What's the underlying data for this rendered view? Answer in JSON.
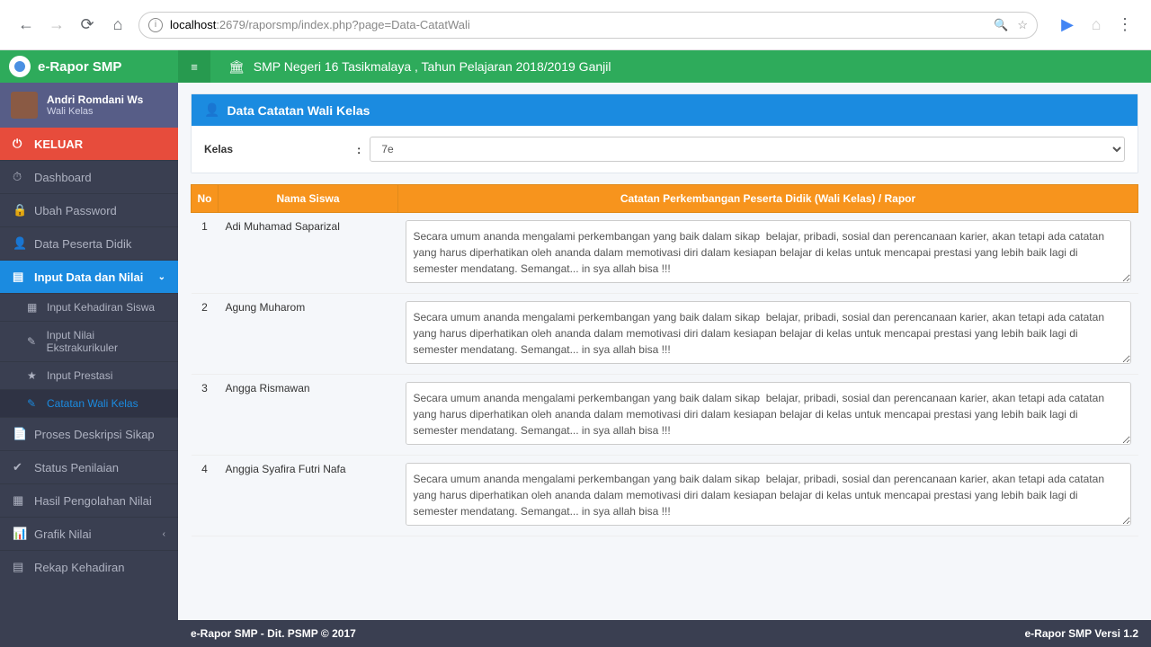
{
  "browser": {
    "url_host": "localhost",
    "url_port": ":2679",
    "url_path": "/raporsmp/index.php?page=Data-CatatWali"
  },
  "brand": "e-Rapor SMP",
  "school_header": "SMP Negeri 16 Tasikmalaya  , Tahun Pelajaran 2018/2019 Ganjil",
  "user": {
    "name": "Andri Romdani Ws",
    "role": "Wali Kelas"
  },
  "nav": {
    "keluar": "KELUAR",
    "items": [
      {
        "icon": "⏱",
        "label": "Dashboard"
      },
      {
        "icon": "🔒",
        "label": "Ubah Password"
      },
      {
        "icon": "👤",
        "label": "Data Peserta Didik"
      }
    ],
    "input_menu": {
      "label": "Input Data dan Nilai",
      "expanded": true
    },
    "input_sub": [
      {
        "label": "Input Kehadiran Siswa",
        "active": false
      },
      {
        "label": "Input Nilai Ekstrakurikuler",
        "active": false
      },
      {
        "label": "Input Prestasi",
        "active": false
      },
      {
        "label": "Catatan Wali Kelas",
        "active": true
      }
    ],
    "after": [
      {
        "icon": "📄",
        "label": "Proses Deskripsi Sikap"
      },
      {
        "icon": "✔",
        "label": "Status Penilaian"
      },
      {
        "icon": "▦",
        "label": "Hasil Pengolahan Nilai"
      },
      {
        "icon": "📊",
        "label": "Grafik Nilai",
        "chevron": "‹"
      },
      {
        "icon": "▤",
        "label": "Rekap Kehadiran"
      }
    ]
  },
  "panel": {
    "title": "Data Catatan Wali Kelas"
  },
  "filter": {
    "label": "Kelas",
    "value": "7e"
  },
  "table": {
    "headers": {
      "no": "No",
      "name": "Nama Siswa",
      "note": "Catatan Perkembangan Peserta Didik (Wali Kelas) / Rapor"
    },
    "rows": [
      {
        "no": "1",
        "name": "Adi Muhamad Saparizal",
        "note": "Secara umum ananda mengalami perkembangan yang baik dalam sikap  belajar, pribadi, sosial dan perencanaan karier, akan tetapi ada catatan yang harus diperhatikan oleh ananda dalam memotivasi diri dalam kesiapan belajar di kelas untuk mencapai prestasi yang lebih baik lagi di semester mendatang. Semangat... in sya allah bisa !!!"
      },
      {
        "no": "2",
        "name": "Agung Muharom",
        "note": "Secara umum ananda mengalami perkembangan yang baik dalam sikap  belajar, pribadi, sosial dan perencanaan karier, akan tetapi ada catatan yang harus diperhatikan oleh ananda dalam memotivasi diri dalam kesiapan belajar di kelas untuk mencapai prestasi yang lebih baik lagi di semester mendatang. Semangat... in sya allah bisa !!!"
      },
      {
        "no": "3",
        "name": "Angga Rismawan",
        "note": "Secara umum ananda mengalami perkembangan yang baik dalam sikap  belajar, pribadi, sosial dan perencanaan karier, akan tetapi ada catatan yang harus diperhatikan oleh ananda dalam memotivasi diri dalam kesiapan belajar di kelas untuk mencapai prestasi yang lebih baik lagi di semester mendatang. Semangat... in sya allah bisa !!!"
      },
      {
        "no": "4",
        "name": "Anggia Syafira Futri Nafa",
        "note": "Secara umum ananda mengalami perkembangan yang baik dalam sikap  belajar, pribadi, sosial dan perencanaan karier, akan tetapi ada catatan yang harus diperhatikan oleh ananda dalam memotivasi diri dalam kesiapan belajar di kelas untuk mencapai prestasi yang lebih baik lagi di semester mendatang. Semangat... in sya allah bisa !!!"
      }
    ]
  },
  "footer": {
    "left": "e-Rapor SMP - Dit. PSMP © 2017",
    "right": "e-Rapor SMP Versi 1.2"
  }
}
